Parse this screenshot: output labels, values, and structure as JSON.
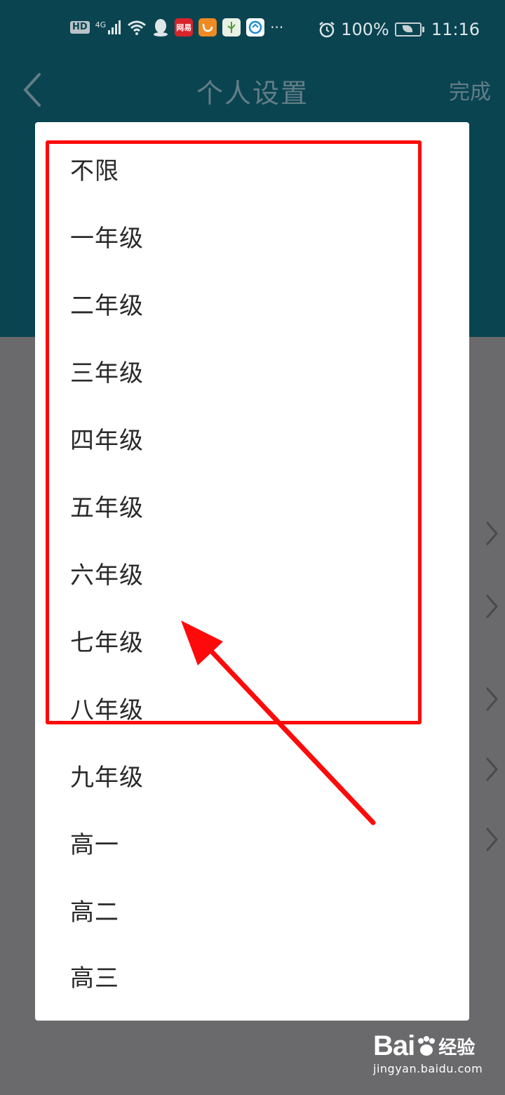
{
  "status_bar": {
    "network": "4G",
    "hd": "HD",
    "battery": "100%",
    "time": "11:16",
    "more": "···",
    "app_icon_netease": "网易"
  },
  "header": {
    "title": "个人设置",
    "done_label": "完成"
  },
  "grade_picker": {
    "options": [
      "不限",
      "一年级",
      "二年级",
      "三年级",
      "四年级",
      "五年级",
      "六年级",
      "七年级",
      "八年级",
      "九年级",
      "高一",
      "高二",
      "高三"
    ]
  },
  "annotation": {
    "box_color": "#ff0a0a",
    "arrow_color": "#ff0a0a"
  },
  "watermark": {
    "logo_text": "Bai",
    "logo_suffix": "经验",
    "url": "jingyan.baidu.com"
  },
  "colors": {
    "header_bg": "#0a4451",
    "dim_overlay": "#6a6a6c",
    "dialog_bg": "#ffffff"
  }
}
